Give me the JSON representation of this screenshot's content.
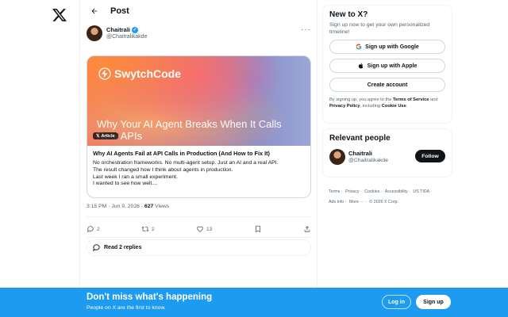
{
  "header": {
    "title": "Post"
  },
  "post": {
    "author": {
      "name": "Chaitrali",
      "handle": "@Chaitralikakde"
    },
    "article": {
      "brand": "SwytchCode",
      "image_headline": "Why Your AI Agent Breaks When It Calls Real APIs",
      "badge": "Article",
      "title": "Why AI Agents Fail at API Calls in Production (And How to Fix It)",
      "lines": [
        "No orchestration frameworks. No multi-agent setup. Just an AI and a real API.",
        "The result changed how I think about agents in production.",
        "Last week I ran a small experiment.",
        "I wanted to see how well...."
      ]
    },
    "timestamp": "3:15 PM · Jun 9, 2026 · ",
    "views_count": "627",
    "views_label": " Views",
    "actions": {
      "replies": "2",
      "reposts": "2",
      "likes": "13"
    },
    "read_replies": "Read 2 replies"
  },
  "sidebar": {
    "new_to_x": {
      "title": "New to X?",
      "subtitle": "Sign up now to get your own personalized timeline!",
      "google": "Sign up with Google",
      "apple": "Sign up with Apple",
      "create": "Create account",
      "legal_pre": "By signing up, you agree to the ",
      "terms": "Terms of Service",
      "legal_mid": " and ",
      "privacy": "Privacy Policy",
      "legal_mid2": ", including ",
      "cookie": "Cookie Use",
      "legal_end": "."
    },
    "relevant": {
      "title": "Relevant people",
      "name": "Chaitrali",
      "handle": "@Chaitralikakde",
      "follow": "Follow"
    },
    "footer": {
      "line1": [
        "Terms ·",
        "Privacy ·",
        "Cookies ·",
        "Accessibility ·",
        "US TIDA ·"
      ],
      "line2": [
        "Ads info ·",
        "More ··· ·",
        "© 2026 X Corp."
      ]
    }
  },
  "banner": {
    "title": "Don't miss what's happening",
    "subtitle": "People on X are the first to know.",
    "login": "Log in",
    "signup": "Sign up"
  },
  "colors": {
    "accent": "#1d9bf0",
    "text": "#0f1419",
    "muted": "#536471"
  }
}
